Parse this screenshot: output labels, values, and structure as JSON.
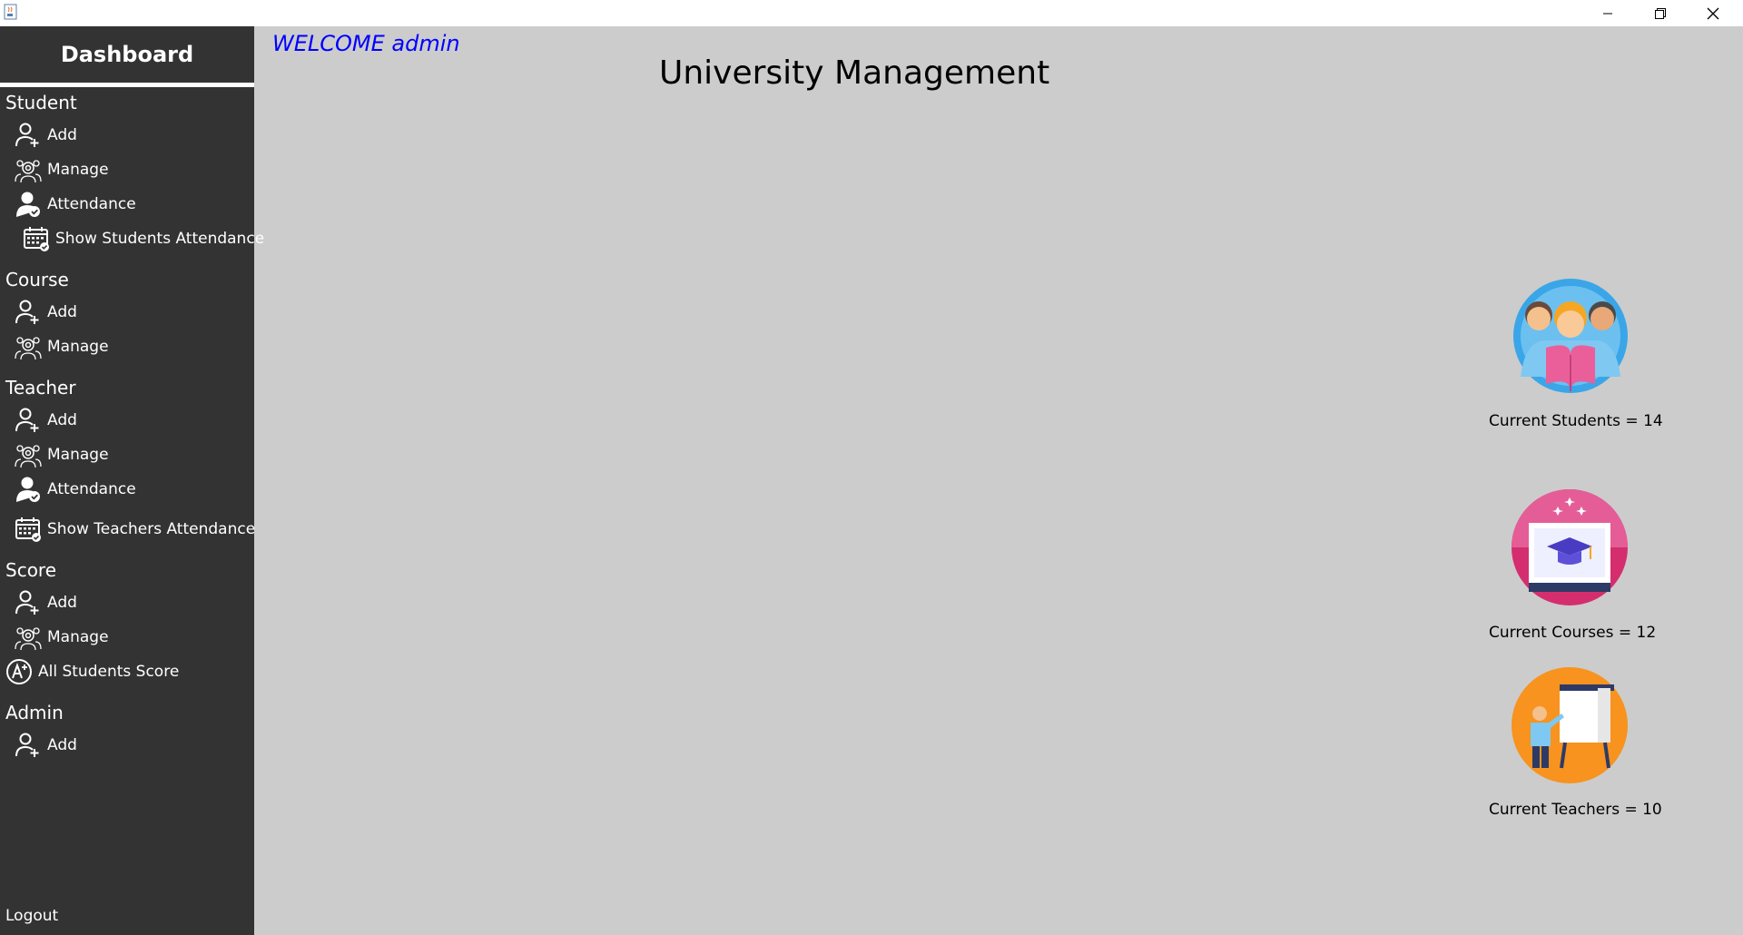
{
  "window": {
    "icon": "java-cup-icon"
  },
  "sidebar": {
    "title": "Dashboard",
    "sections": [
      {
        "title": "Student",
        "items": [
          {
            "label": "Add",
            "icon": "add-user-icon"
          },
          {
            "label": "Manage",
            "icon": "manage-group-icon"
          },
          {
            "label": "Attendance",
            "icon": "attendance-icon"
          },
          {
            "label": "Show Students Attendance",
            "icon": "calendar-check-icon"
          }
        ]
      },
      {
        "title": "Course",
        "items": [
          {
            "label": "Add",
            "icon": "add-user-icon"
          },
          {
            "label": "Manage",
            "icon": "manage-group-icon"
          }
        ]
      },
      {
        "title": "Teacher",
        "items": [
          {
            "label": "Add",
            "icon": "add-user-icon"
          },
          {
            "label": "Manage",
            "icon": "manage-group-icon"
          },
          {
            "label": "Attendance",
            "icon": "attendance-icon"
          },
          {
            "label": "Show Teachers Attendance",
            "icon": "calendar-check-icon"
          }
        ]
      },
      {
        "title": "Score",
        "items": [
          {
            "label": "Add",
            "icon": "add-user-icon"
          },
          {
            "label": "Manage",
            "icon": "manage-group-icon"
          },
          {
            "label": "All Students Score",
            "icon": "grade-a-plus-icon"
          }
        ]
      },
      {
        "title": "Admin",
        "items": [
          {
            "label": "Add",
            "icon": "add-user-icon"
          }
        ]
      }
    ],
    "logout": "Logout"
  },
  "main": {
    "welcome": "WELCOME admin",
    "title": "University Management",
    "stats": [
      {
        "label": "Current Students = 14",
        "icon": "students-reading-icon"
      },
      {
        "label": "Current Courses = 12",
        "icon": "graduation-cap-screen-icon"
      },
      {
        "label": "Current Teachers = 10",
        "icon": "teacher-board-icon"
      }
    ]
  },
  "colors": {
    "sidebar_bg": "#333333",
    "main_bg": "#cccccc",
    "welcome": "#0000ff"
  }
}
